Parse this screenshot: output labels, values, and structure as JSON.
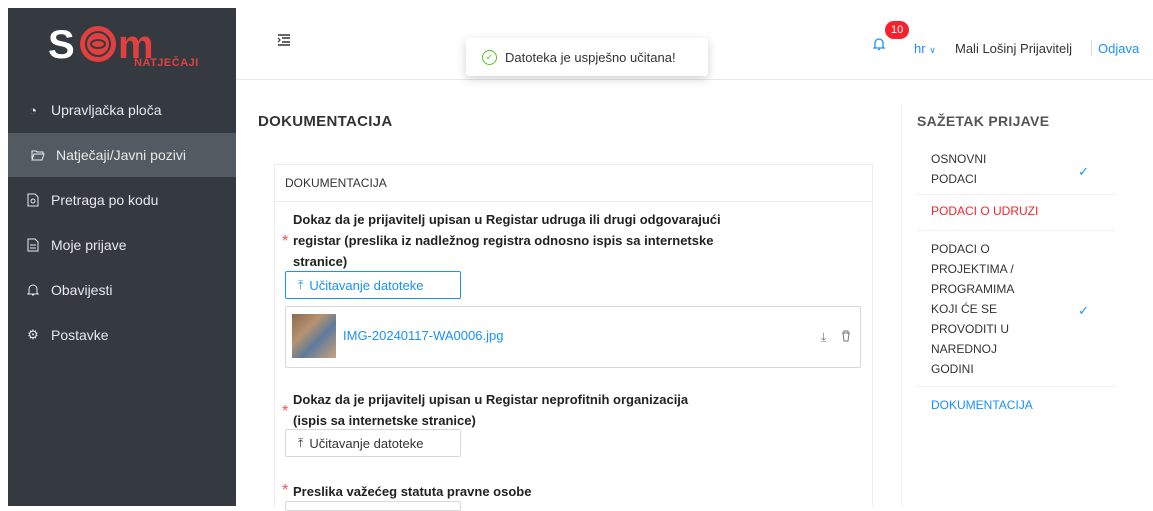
{
  "logo": {
    "text": "SOM",
    "subtitle": "NATJEČAJI"
  },
  "sidebar": {
    "items": [
      {
        "label": "Upravljačka ploča",
        "icon": "dashboard-icon"
      },
      {
        "label": "Natječaji/Javni pozivi",
        "icon": "folder-open-icon",
        "active": true
      },
      {
        "label": "Pretraga po kodu",
        "icon": "file-search-icon"
      },
      {
        "label": "Moje prijave",
        "icon": "file-text-icon"
      },
      {
        "label": "Obavijesti",
        "icon": "bell-icon"
      },
      {
        "label": "Postavke",
        "icon": "gear-icon"
      }
    ]
  },
  "header": {
    "notification_count": "10",
    "language": "hr",
    "user": "Mali Lošinj Prijavitelj",
    "logout": "Odjava"
  },
  "toast": {
    "message": "Datoteka je uspješno učitana!"
  },
  "main": {
    "page_title": "DOKUMENTACIJA",
    "card_title": "DOKUMENTACIJA",
    "fields": [
      {
        "label_lines": [
          "Dokaz da je prijavitelj upisan u Registar udruga ili drugi odgovarajući",
          "registar (preslika iz nadležnog registra odnosno ispis sa internetske",
          "stranice)"
        ],
        "button": "Učitavanje datoteke",
        "file": "IMG-20240117-WA0006.jpg"
      },
      {
        "label_lines": [
          "Dokaz da je prijavitelj upisan u Registar neprofitnih organizacija",
          "(ispis sa internetske stranice)"
        ],
        "button": "Učitavanje datoteke"
      },
      {
        "label_lines": [
          "Preslika važećeg statuta pravne osobe"
        ]
      }
    ]
  },
  "summary": {
    "title": "SAŽETAK PRIJAVE",
    "items": [
      {
        "lines": [
          "OSNOVNI",
          "PODACI"
        ],
        "status": "done"
      },
      {
        "lines": [
          "PODACI O UDRUZI"
        ],
        "status": "error"
      },
      {
        "lines": [
          "PODACI O",
          "PROJEKTIMA /",
          "PROGRAMIMA",
          "KOJI ĆE SE",
          "PROVODITI U",
          "NAREDNOJ",
          "GODINI"
        ],
        "status": "done"
      },
      {
        "lines": [
          "DOKUMENTACIJA"
        ],
        "status": "current"
      }
    ]
  },
  "colors": {
    "sidebar_bg": "#353a40",
    "active_item": "#545a61",
    "accent": "#1890ff",
    "error": "#f5222d",
    "success": "#52c41a"
  }
}
